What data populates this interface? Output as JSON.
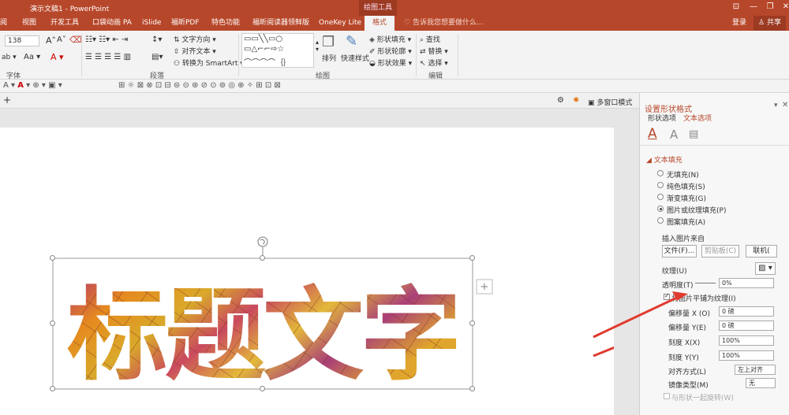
{
  "window": {
    "title": "演示文稿1 - PowerPoint",
    "context_tools": "绘图工具",
    "minimize": "—",
    "restore": "❐",
    "close": "✕",
    "ribbon_opts": "⊡"
  },
  "tabs": [
    {
      "label": "阅"
    },
    {
      "label": "视图"
    },
    {
      "label": "开发工具"
    },
    {
      "label": "口袋动画 PA"
    },
    {
      "label": "iSlide"
    },
    {
      "label": "福昕PDF"
    },
    {
      "label": "特色功能"
    },
    {
      "label": "福昕阅读器领鲜版"
    },
    {
      "label": "OneKey Lite"
    },
    {
      "label": "格式"
    }
  ],
  "tell_me": "告诉我您想要做什么...",
  "login": "登录",
  "share": "共享",
  "ribbon": {
    "font_size": "138",
    "font_group": "字体",
    "para_group": "段落",
    "draw_group": "绘图",
    "edit_group": "编辑",
    "text_direction": "文字方向",
    "align_text": "对齐文本",
    "smartart": "转换为 SmartArt",
    "arrange": "排列",
    "quick_styles": "快速样式",
    "shape_fill": "形状填充",
    "shape_outline": "形状轮廓",
    "shape_effects": "形状效果",
    "find": "查找",
    "replace": "替换",
    "select": "选择"
  },
  "multi_window": "多窗口模式",
  "slide_text": "标题文字",
  "pane": {
    "title": "设置形状格式",
    "tab_shape": "形状选项",
    "tab_text": "文本选项",
    "section": "文本填充",
    "radios": [
      {
        "label": "无填充(N)",
        "on": false
      },
      {
        "label": "纯色填充(S)",
        "on": false
      },
      {
        "label": "渐变填充(G)",
        "on": false
      },
      {
        "label": "图片或纹理填充(P)",
        "on": true
      },
      {
        "label": "图案填充(A)",
        "on": false
      }
    ],
    "insert_from": "插入图片来自",
    "file_btn": "文件(F)...",
    "clipboard_btn": "剪贴板(C)",
    "online_btn": "联机(",
    "texture": "纹理(U)",
    "transparency": "透明度(T)",
    "transparency_val": "0%",
    "tile_check": "将图片平铺为纹理(I)",
    "offset_x": "偏移量 X (O)",
    "offset_x_val": "0 磅",
    "offset_y": "偏移量 Y(E)",
    "offset_y_val": "0 磅",
    "scale_x": "刻度 X(X)",
    "scale_x_val": "100%",
    "scale_y": "刻度 Y(Y)",
    "scale_y_val": "100%",
    "align": "对齐方式(L)",
    "align_val": "左上对齐",
    "mirror": "镜像类型(M)",
    "mirror_val": "无",
    "rotate": "与形状一起旋转(W)"
  },
  "colors": {
    "accent": "#b7472a",
    "arrow": "#e03a2f"
  }
}
